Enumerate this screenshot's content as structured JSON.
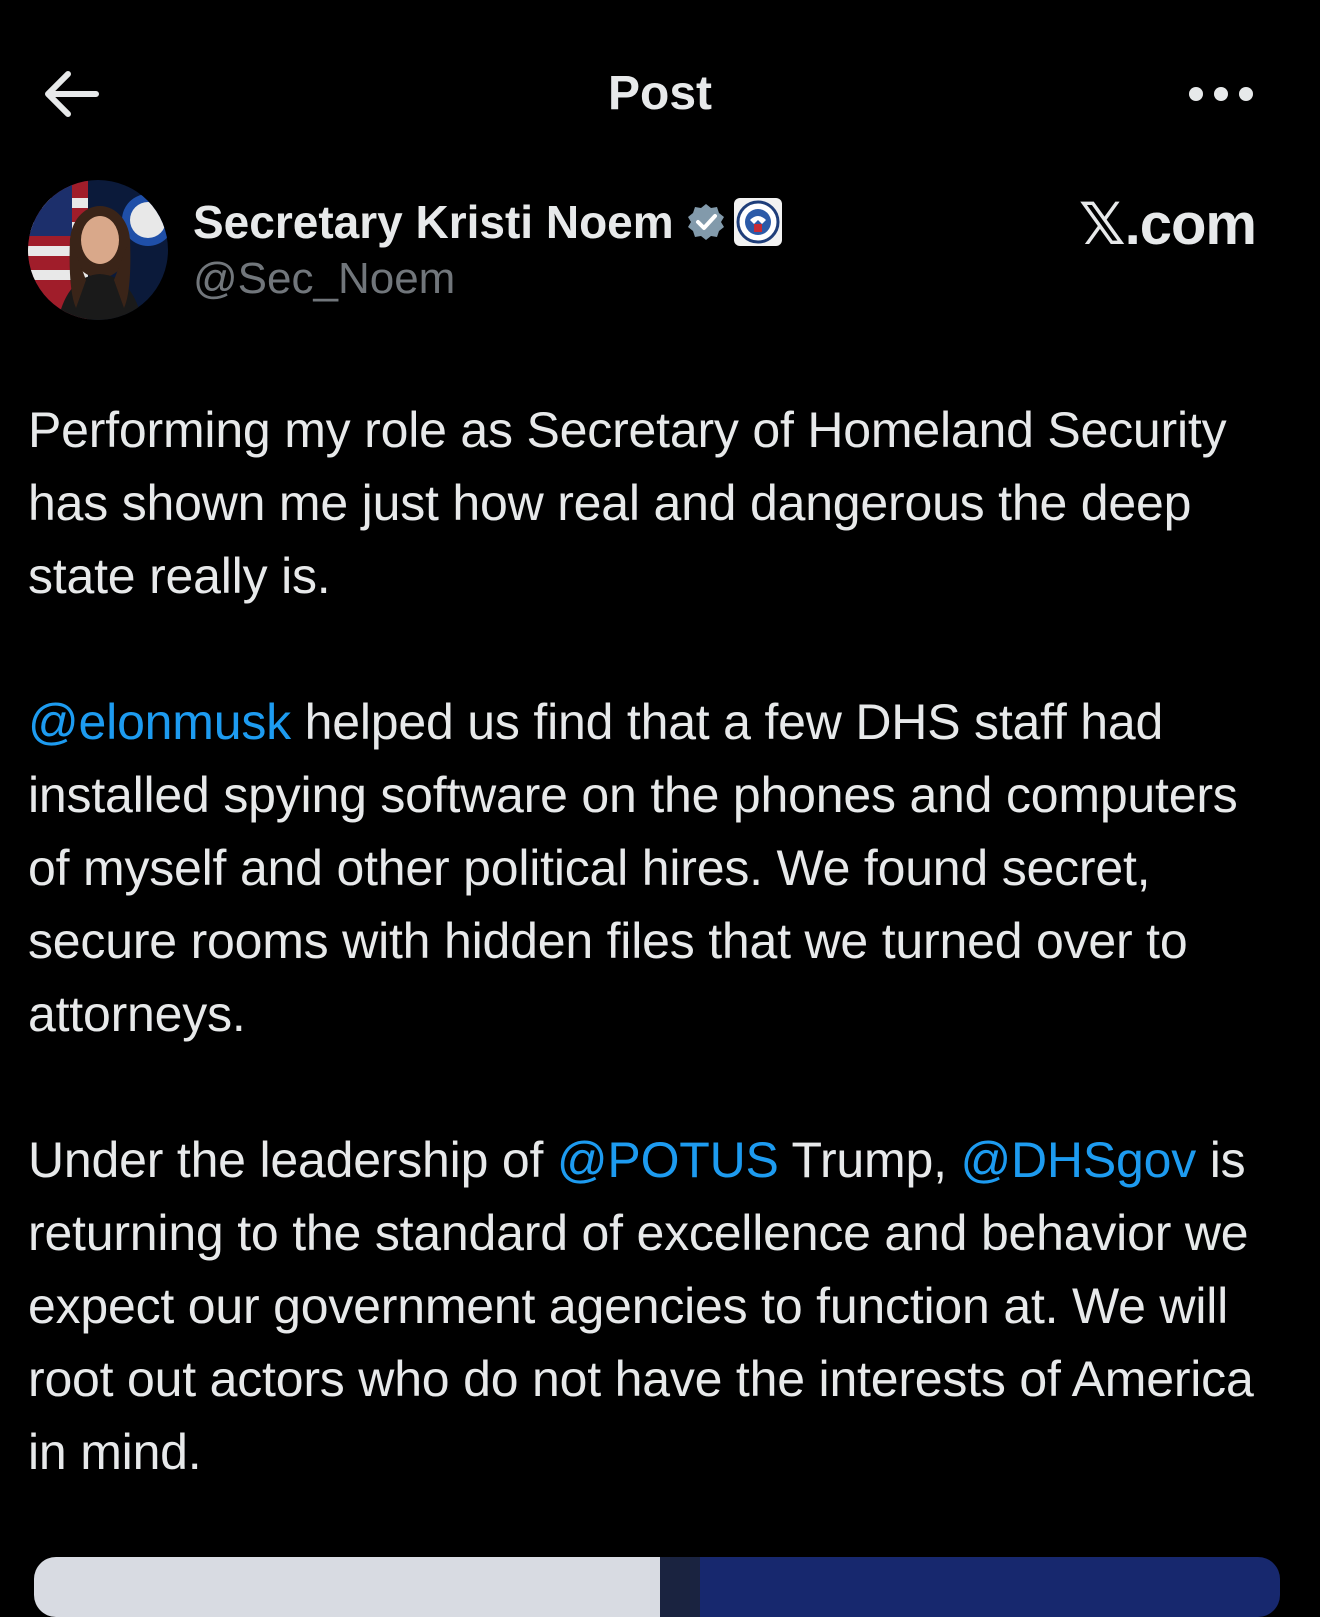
{
  "header": {
    "title": "Post",
    "back_icon": "arrow-left-icon",
    "more_icon": "more-horizontal-icon"
  },
  "author": {
    "name": "Secretary Kristi Noem",
    "handle": "@Sec_Noem",
    "verified_icon": "verified-badge-icon",
    "affiliation_icon": "dhs-seal-icon"
  },
  "brand": {
    "watermark": "𝕏.com"
  },
  "post": {
    "p1": "Performing my role as Secretary of Homeland Security has shown me just how real and dangerous the deep state really is.",
    "p2": {
      "mention": "@elonmusk",
      "text": " helped us find that a few DHS staff had installed spying software on the phones and computers of myself and other political hires. We found secret, secure rooms with hidden files that we turned over to attorneys."
    },
    "p3": {
      "text_a": "Under the leadership of ",
      "mention_a": "@POTUS",
      "text_b": " Trump, ",
      "mention_b": "@DHSgov",
      "text_c": " is returning to the standard of excellence and behavior we expect our government agencies to function at. We will root out actors who do not have the interests of America in mind."
    }
  },
  "colors": {
    "background": "#000000",
    "text_primary": "#e7e9ea",
    "text_secondary": "#71767b",
    "accent_link": "#1d9bf0",
    "verified_badge": "#829aab"
  }
}
